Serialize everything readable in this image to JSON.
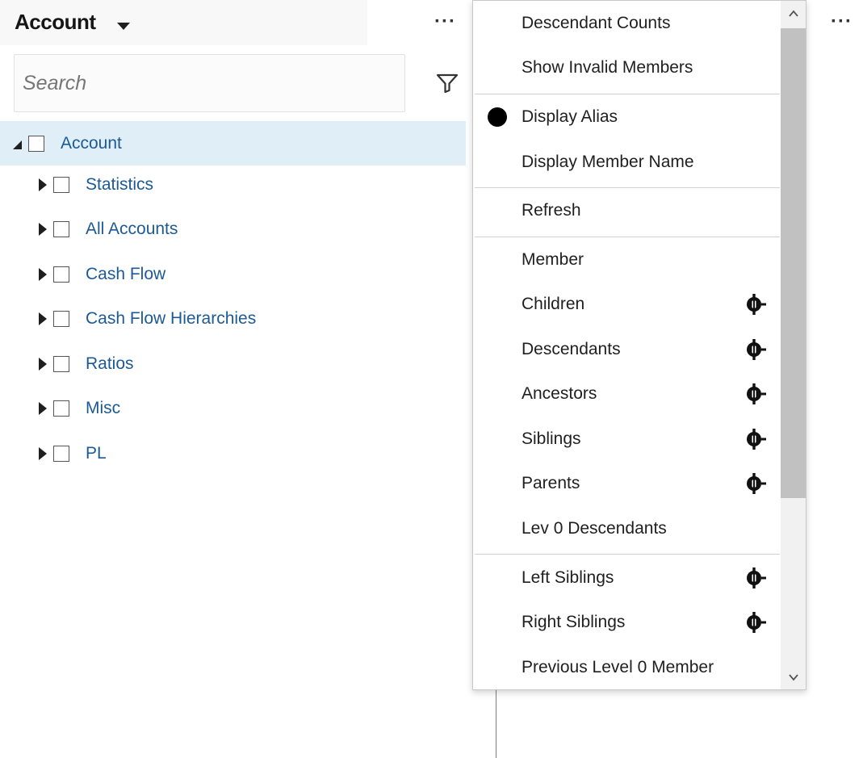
{
  "header": {
    "title": "Account",
    "left_ellipsis": "···",
    "right_ellipsis": "···"
  },
  "search": {
    "placeholder": "Search",
    "value": ""
  },
  "tree": {
    "root": {
      "label": "Account",
      "expanded": true,
      "selected": true
    },
    "children": [
      {
        "label": "Statistics"
      },
      {
        "label": "All Accounts"
      },
      {
        "label": "Cash Flow"
      },
      {
        "label": "Cash Flow Hierarchies"
      },
      {
        "label": "Ratios"
      },
      {
        "label": "Misc"
      },
      {
        "label": "PL"
      }
    ]
  },
  "menu": {
    "items": [
      {
        "label": "Descendant Counts"
      },
      {
        "label": "Show Invalid Members"
      },
      {
        "label": "Display Alias",
        "selected": true
      },
      {
        "label": "Display Member Name"
      },
      {
        "label": "Refresh"
      },
      {
        "label": "Member"
      },
      {
        "label": "Children",
        "icon": "pin-selector-icon"
      },
      {
        "label": "Descendants",
        "icon": "pin-selector-icon"
      },
      {
        "label": "Ancestors",
        "icon": "pin-selector-icon"
      },
      {
        "label": "Siblings",
        "icon": "pin-selector-icon"
      },
      {
        "label": "Parents",
        "icon": "pin-selector-icon"
      },
      {
        "label": "Lev 0 Descendants"
      },
      {
        "label": "Left Siblings",
        "icon": "pin-selector-icon"
      },
      {
        "label": "Right Siblings",
        "icon": "pin-selector-icon"
      },
      {
        "label": "Previous Level 0 Member"
      }
    ]
  },
  "colors": {
    "link": "#1c5a96",
    "selected_row": "#e0eef8",
    "scroll_thumb": "#c1c1c1"
  }
}
